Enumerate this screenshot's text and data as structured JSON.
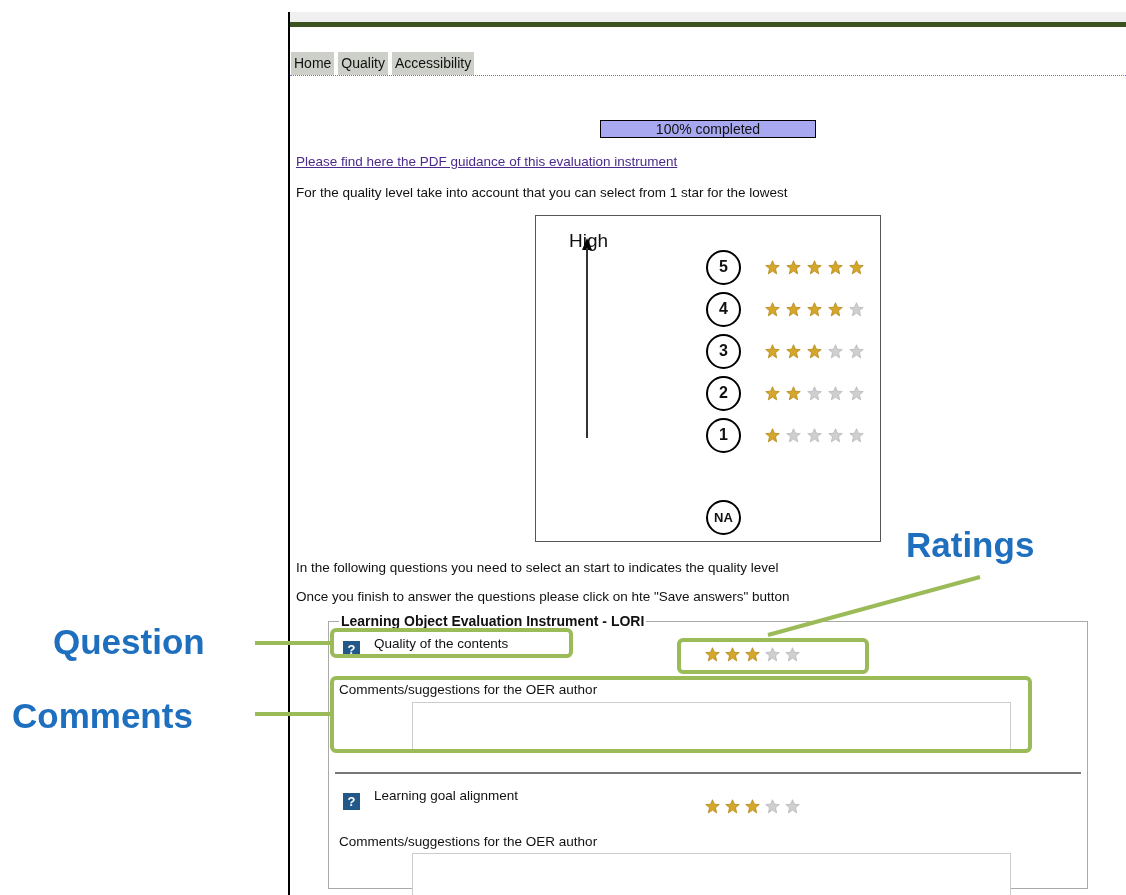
{
  "tabs": [
    {
      "label": "Home"
    },
    {
      "label": "Quality"
    },
    {
      "label": "Accessibility"
    }
  ],
  "progress": {
    "level": 1,
    "reading": "100% completed"
  },
  "guidance_link": "Please find here the PDF guidance of this evaluation instrument",
  "intro": "For the quality level take into account that you can select from 1 star for the lowest",
  "scale_diagram": {
    "axis_label": "High",
    "levels": [
      {
        "label": "5",
        "stars": 5
      },
      {
        "label": "4",
        "stars": 4
      },
      {
        "label": "3",
        "stars": 3
      },
      {
        "label": "2",
        "stars": 2
      },
      {
        "label": "1",
        "stars": 1
      }
    ],
    "na_label": "NA"
  },
  "instructions": [
    "In the following questions you need to select an start to indicates the quality level",
    "Once you finish to answer the questions please click on hte \"Save answers\" button"
  ],
  "form": {
    "legend": "Learning Object Evaluation Instrument - LORI",
    "questions": [
      {
        "help": "?",
        "title": "Quality of the contents",
        "stars": 3,
        "comment_label": "Comments/suggestions for the OER author"
      },
      {
        "help": "?",
        "title": "Learning goal alignment",
        "stars": 3,
        "comment_label": "Comments/suggestions for the OER author"
      }
    ]
  },
  "annotations": [
    {
      "kind": "question",
      "text": "Question"
    },
    {
      "kind": "ratings",
      "text": "Ratings"
    },
    {
      "kind": "comments",
      "text": "Comments"
    }
  ]
}
